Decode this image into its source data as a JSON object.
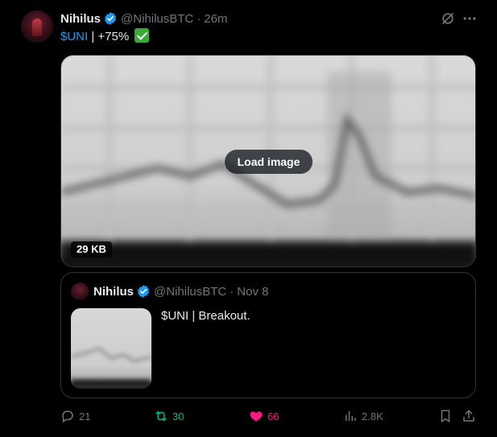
{
  "author": {
    "name": "Nihilus",
    "handle": "@NihilusBTC",
    "separator": "·",
    "time": "26m"
  },
  "tweet": {
    "cashtag": "$UNI",
    "text_rest": " | +75%"
  },
  "media": {
    "load_label": "Load image",
    "size_label": "29 KB"
  },
  "quote": {
    "name": "Nihilus",
    "handle": "@NihilusBTC",
    "separator": "·",
    "date": "Nov 8",
    "text": "$UNI | Breakout."
  },
  "metrics": {
    "replies": "21",
    "reposts": "30",
    "likes": "66",
    "views": "2.8K"
  },
  "colors": {
    "link": "#1d9bf0",
    "repost_active": "#00ba7c",
    "like_active": "#f91880",
    "muted": "#71767b",
    "verified": "#1d9bf0"
  },
  "icons": {
    "verified": "verified-badge-icon",
    "grok": "grok-icon",
    "more": "more-icon",
    "reply": "reply-icon",
    "repost": "repost-icon",
    "like": "heart-icon",
    "views": "views-icon",
    "bookmark": "bookmark-icon",
    "share": "share-icon",
    "check": "check-mark-icon"
  }
}
